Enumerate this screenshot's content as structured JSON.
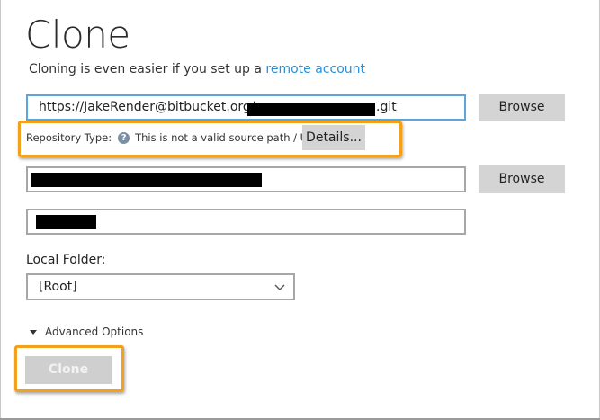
{
  "header": {
    "title": "Clone",
    "subtitle_prefix": "Cloning is even easier if you set up a ",
    "subtitle_link": "remote account"
  },
  "source": {
    "url_prefix": "https://JakeRender@bitbucket.org/",
    "url_suffix": ".git",
    "browse_label": "Browse"
  },
  "repository_type": {
    "label": "Repository Type:",
    "message": "This is not a valid source path / URL",
    "details_label": "Details..."
  },
  "destination": {
    "browse_label": "Browse"
  },
  "local_folder": {
    "label": "Local Folder:",
    "selected": "[Root]"
  },
  "advanced": {
    "label": "Advanced Options"
  },
  "actions": {
    "clone_label": "Clone"
  },
  "colors": {
    "accent_link": "#2d8fd5",
    "highlight": "#f2a11c",
    "focus_border": "#5aa6e0"
  }
}
